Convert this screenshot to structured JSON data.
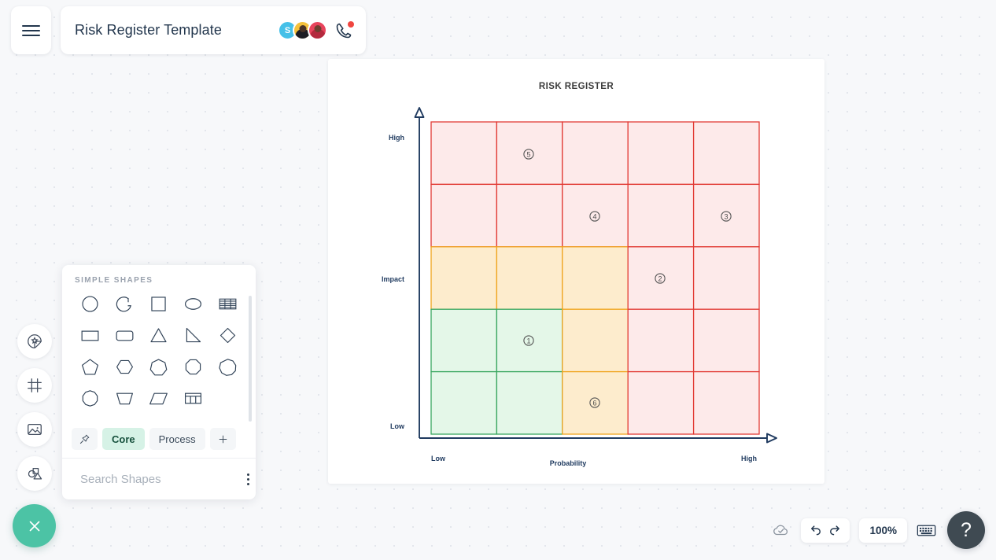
{
  "header": {
    "menu_icon": "hamburger-icon",
    "doc_title": "Risk Register Template",
    "avatars": [
      {
        "name": "avatar-s",
        "initial": "S",
        "color": "#45c0e8",
        "type": "initial"
      },
      {
        "name": "avatar-user-2",
        "initial": "",
        "color": "#f5c13b",
        "type": "photo"
      },
      {
        "name": "avatar-user-3",
        "initial": "",
        "color": "#e8445c",
        "type": "photo"
      }
    ],
    "call_icon": "phone-call-icon",
    "call_badge": "active"
  },
  "left_rail": {
    "items": [
      {
        "name": "sticker-icon",
        "label": "Stickers"
      },
      {
        "name": "frame-icon",
        "label": "Frames"
      },
      {
        "name": "image-icon",
        "label": "Images"
      },
      {
        "name": "shapes-icon",
        "label": "Shapes"
      }
    ]
  },
  "fab": {
    "icon": "close-icon",
    "color": "#4cc3a5"
  },
  "shapes_panel": {
    "section_title": "SIMPLE SHAPES",
    "shapes": [
      {
        "name": "circle-shape",
        "glyph": "circle"
      },
      {
        "name": "arc-shape",
        "glyph": "arc"
      },
      {
        "name": "square-shape",
        "glyph": "square"
      },
      {
        "name": "ellipse-shape",
        "glyph": "ellipse"
      },
      {
        "name": "list-table-shape",
        "glyph": "striped-table"
      },
      {
        "name": "rectangle-shape",
        "glyph": "rectangle"
      },
      {
        "name": "rounded-rectangle-shape",
        "glyph": "rounded-rect"
      },
      {
        "name": "triangle-shape",
        "glyph": "triangle"
      },
      {
        "name": "right-triangle-shape",
        "glyph": "right-triangle"
      },
      {
        "name": "diamond-shape",
        "glyph": "diamond"
      },
      {
        "name": "pentagon-shape",
        "glyph": "pentagon"
      },
      {
        "name": "hexagon-shape",
        "glyph": "hexagon"
      },
      {
        "name": "heptagon-shape",
        "glyph": "heptagon"
      },
      {
        "name": "octagon-shape",
        "glyph": "octagon"
      },
      {
        "name": "nonagon-shape",
        "glyph": "nonagon"
      },
      {
        "name": "decagon-shape",
        "glyph": "decagon"
      },
      {
        "name": "trapezoid-shape",
        "glyph": "trapezoid"
      },
      {
        "name": "parallelogram-shape",
        "glyph": "parallelogram"
      },
      {
        "name": "table-shape",
        "glyph": "table"
      }
    ],
    "tabs": [
      {
        "name": "pin-tab",
        "label": "",
        "icon": "pin-icon",
        "active": false
      },
      {
        "name": "core-tab",
        "label": "Core",
        "active": true
      },
      {
        "name": "process-tab",
        "label": "Process",
        "active": false
      },
      {
        "name": "add-tab",
        "label": "+",
        "active": false
      }
    ],
    "search_placeholder": "Search Shapes",
    "search_value": "",
    "search_icon": "search-icon",
    "more_icon": "more-vertical-icon"
  },
  "bottom_bar": {
    "cloud_icon": "cloud-saved-icon",
    "undo_icon": "undo-icon",
    "redo_icon": "redo-icon",
    "zoom_level": "100%",
    "keyboard_icon": "keyboard-icon",
    "help_label": "?"
  },
  "chart_data": {
    "type": "heatmap",
    "title": "RISK REGISTER",
    "xlabel": "Probability",
    "ylabel": "Impact",
    "x_tick_low": "Low",
    "x_tick_high": "High",
    "y_tick_low": "Low",
    "y_tick_high": "High",
    "grid": {
      "cols": 5,
      "rows": 5
    },
    "colors": {
      "green_fill": "#e4f7e8",
      "green_stroke": "#3aa760",
      "amber_fill": "#fdeccd",
      "amber_stroke": "#f0a51e",
      "red_fill": "#fdeaea",
      "red_stroke": "#e23b35",
      "axis": "#1f3a5f"
    },
    "cells": [
      [
        "red",
        "red",
        "red",
        "red",
        "red"
      ],
      [
        "red",
        "red",
        "red",
        "red",
        "red"
      ],
      [
        "amber",
        "amber",
        "amber",
        "red",
        "red"
      ],
      [
        "green",
        "green",
        "amber",
        "red",
        "red"
      ],
      [
        "green",
        "green",
        "amber",
        "red",
        "red"
      ]
    ],
    "markers": [
      {
        "label": "5",
        "col": 2,
        "row": 1,
        "zone": "red"
      },
      {
        "label": "4",
        "col": 3,
        "row": 2,
        "zone": "red"
      },
      {
        "label": "3",
        "col": 5,
        "row": 2,
        "zone": "red"
      },
      {
        "label": "2",
        "col": 4,
        "row": 3,
        "zone": "red"
      },
      {
        "label": "1",
        "col": 2,
        "row": 4,
        "zone": "green"
      },
      {
        "label": "6",
        "col": 3,
        "row": 5,
        "zone": "amber"
      }
    ]
  }
}
